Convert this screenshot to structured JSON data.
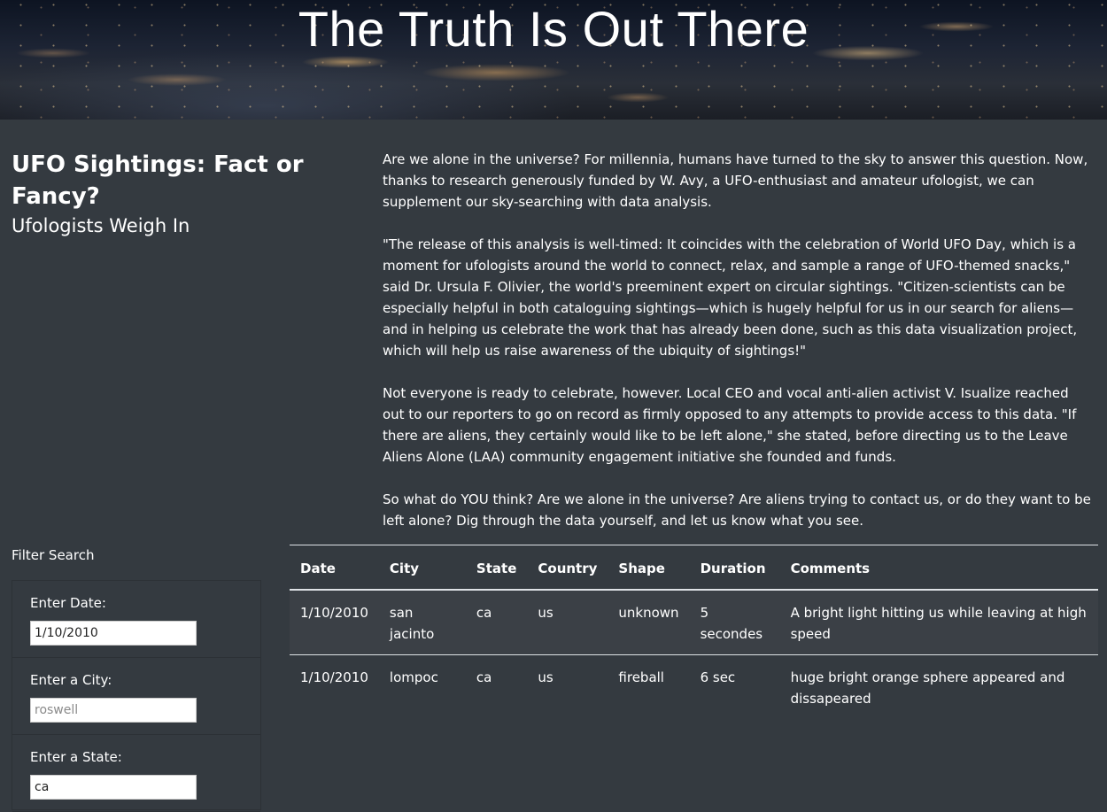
{
  "hero": {
    "title": "The Truth Is Out There"
  },
  "intro": {
    "heading": "UFO Sightings: Fact or Fancy?",
    "subheading": "Ufologists Weigh In",
    "paragraphs": [
      "Are we alone in the universe? For millennia, humans have turned to the sky to answer this question. Now, thanks to research generously funded by W. Avy, a UFO-enthusiast and amateur ufologist, we can supplement our sky-searching with data analysis.",
      "\"The release of this analysis is well-timed: It coincides with the celebration of World UFO Day, which is a moment for ufologists around the world to connect, relax, and sample a range of UFO-themed snacks,\" said Dr. Ursula F. Olivier, the world's preeminent expert on circular sightings. \"Citizen-scientists can be especially helpful in both cataloguing sightings—which is hugely helpful for us in our search for aliens—and in helping us celebrate the work that has already been done, such as this data visualization project, which will help us raise awareness of the ubiquity of sightings!\"",
      "Not everyone is ready to celebrate, however. Local CEO and vocal anti-alien activist V. Isualize reached out to our reporters to go on record as firmly opposed to any attempts to provide access to this data. \"If there are aliens, they certainly would like to be left alone,\" she stated, before directing us to the Leave Aliens Alone (LAA) community engagement initiative she founded and funds.",
      "So what do YOU think? Are we alone in the universe? Are aliens trying to contact us, or do they want to be left alone? Dig through the data yourself, and let us know what you see."
    ]
  },
  "filters": {
    "title": "Filter Search",
    "items": [
      {
        "label": "Enter Date:",
        "value": "1/10/2010",
        "placeholder": ""
      },
      {
        "label": "Enter a City:",
        "value": "",
        "placeholder": "roswell"
      },
      {
        "label": "Enter a State:",
        "value": "ca",
        "placeholder": ""
      }
    ]
  },
  "table": {
    "headers": [
      "Date",
      "City",
      "State",
      "Country",
      "Shape",
      "Duration",
      "Comments"
    ],
    "rows": [
      [
        "1/10/2010",
        "san jacinto",
        "ca",
        "us",
        "unknown",
        "5 secondes",
        "A bright light hitting us while leaving at high speed"
      ],
      [
        "1/10/2010",
        "lompoc",
        "ca",
        "us",
        "fireball",
        "6 sec",
        "huge bright orange sphere appeared and dissapeared"
      ]
    ]
  },
  "colors": {
    "background": "#343a40",
    "text": "#ffffff",
    "stripe": "#3b4046"
  }
}
